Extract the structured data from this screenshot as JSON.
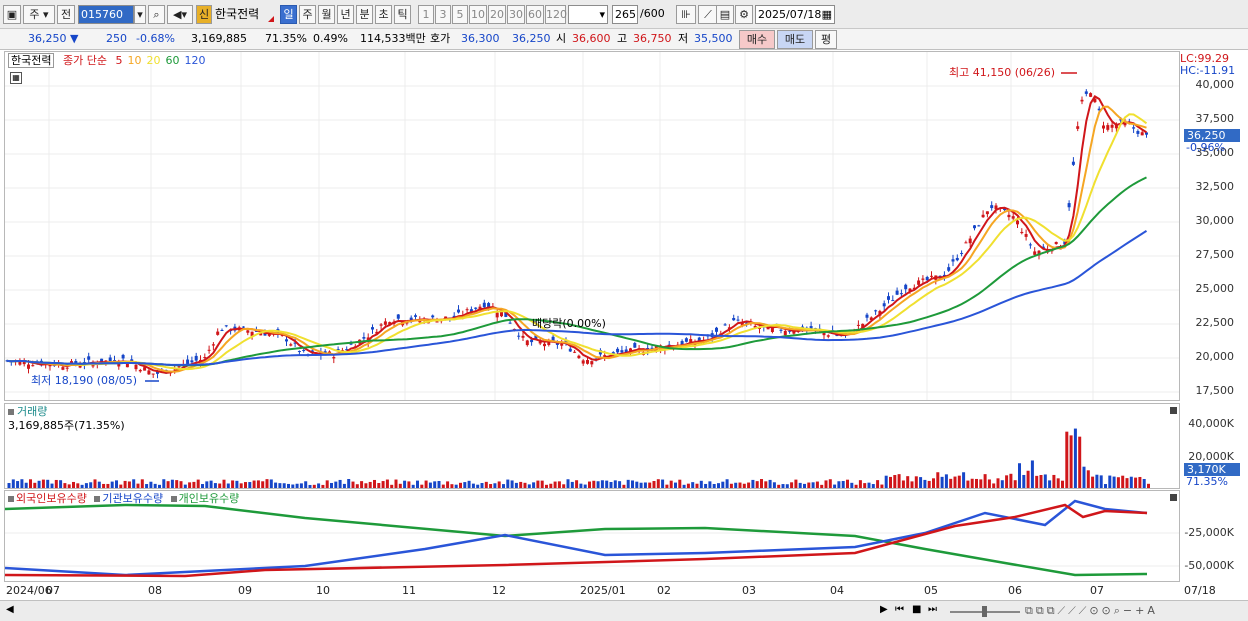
{
  "toolbar": {
    "freq": "주",
    "type": "전",
    "code": "015760",
    "stock_badge": "신",
    "stock_name": "한국전력",
    "periods": [
      "일",
      "주",
      "월",
      "년",
      "분",
      "초",
      "틱"
    ],
    "active_period": "일",
    "intervals": [
      "1",
      "3",
      "5",
      "10",
      "20",
      "30",
      "60",
      "120"
    ],
    "count": "265",
    "count_total": "/600",
    "date": "2025/07/18"
  },
  "quote": {
    "price": "36,250",
    "arrow": "▼",
    "change": "250",
    "change_pct": "-0.68%",
    "volume": "3,169,885",
    "vol_ratio": "71.35%",
    "turnover": "0.49%",
    "amount": "114,533백만",
    "hoga_label": "호가",
    "ask": "36,300",
    "bid": "36,250",
    "open_label": "시",
    "open": "36,600",
    "high_label": "고",
    "high": "36,750",
    "low_label": "저",
    "low": "35,500",
    "buy": "매수",
    "sell": "매도",
    "eval": "평"
  },
  "price_panel": {
    "stock_label": "한국전력",
    "ma_label": "종가 단순",
    "ma_periods": [
      "5",
      "10",
      "20",
      "60",
      "120"
    ],
    "ma_colors": [
      "#d0161a",
      "#f5a623",
      "#f0e030",
      "#1e9a3a",
      "#2a55d8"
    ],
    "high_note": "최고 41,150 (06/26)",
    "low_note": "최저 18,190 (08/05)",
    "dividend_note": "배당락(0.00%)",
    "lc": "LC:99.29",
    "hc": "HC:-11.91",
    "last_price": "36,250",
    "last_pct": "-0.96%",
    "y_labels": [
      "40,000",
      "37,500",
      "35,000",
      "32,500",
      "30,000",
      "27,500",
      "25,000",
      "22,500",
      "20,000",
      "17,500"
    ]
  },
  "volume_panel": {
    "title": "거래량",
    "value": "3,169,885주(71.35%)",
    "y_labels": [
      "40,000K",
      "20,000K"
    ],
    "last_vol": "3,170K",
    "last_pct": "71.35%"
  },
  "holding_panel": {
    "legend": [
      "외국인보유수량",
      "기관보유수량",
      "개인보유수량"
    ],
    "legend_colors": [
      "#d0161a",
      "#1646c8",
      "#1e9a3a"
    ],
    "y_labels": [
      "-25,000K",
      "-50,000K"
    ]
  },
  "x_labels": [
    "2024/06",
    "07",
    "08",
    "09",
    "10",
    "11",
    "12",
    "2025/01",
    "02",
    "03",
    "04",
    "05",
    "06",
    "07"
  ],
  "x_end_label": "07/18"
}
